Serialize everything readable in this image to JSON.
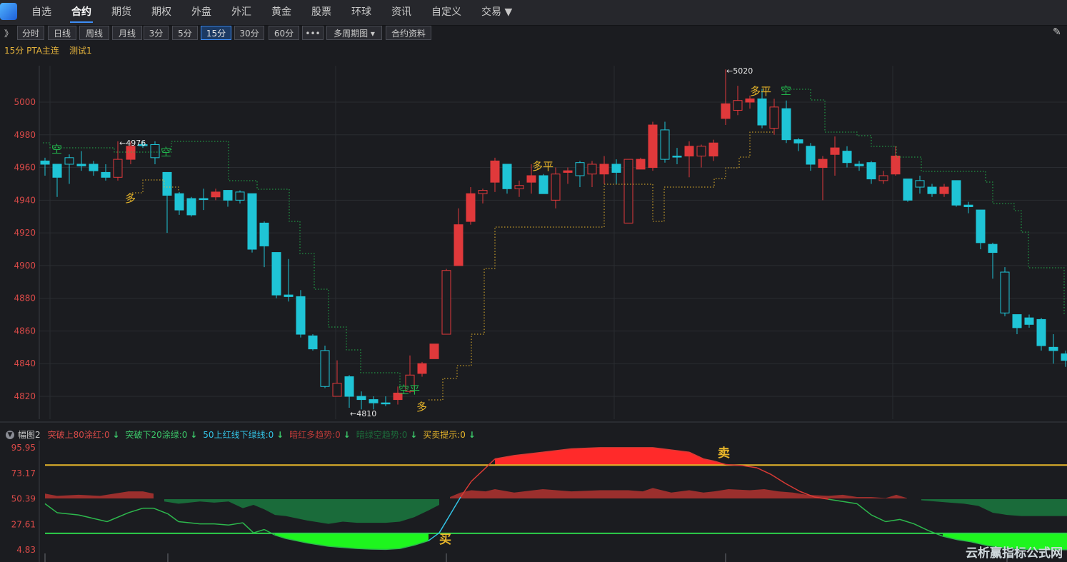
{
  "app": {
    "logo": "chart-logo"
  },
  "nav": {
    "items": [
      "自选",
      "合约",
      "期货",
      "期权",
      "外盘",
      "外汇",
      "黄金",
      "股票",
      "环球",
      "资讯",
      "自定义",
      "交易"
    ],
    "active": 1,
    "dropdown_arrow": "▼"
  },
  "toolbar": {
    "expand": "》",
    "items": [
      "分时",
      "日线",
      "周线",
      "月线",
      "3分",
      "5分",
      "15分",
      "30分",
      "60分",
      "•••",
      "多周期图 ▾",
      "合约资料"
    ],
    "active": "15分",
    "edit_icon": "✎"
  },
  "title": {
    "contract": "15分 PTA主连",
    "indicator": "测试1"
  },
  "main_chart": {
    "y_ticks": [
      "5000",
      "4980",
      "4960",
      "4940",
      "4920",
      "4900",
      "4880",
      "4860",
      "4840",
      "4820"
    ],
    "annotations": {
      "high": "←5020",
      "low": "←4810",
      "local_high": "←4976"
    },
    "signals": {
      "duo": "多",
      "kong": "空",
      "duoping": "多平",
      "kongping": "空平"
    },
    "colors": {
      "up": "#e0393b",
      "down": "#1fc4d6",
      "text": "#d94a48",
      "duo": "#e8b62a",
      "kong": "#22b34b"
    }
  },
  "sub_chart": {
    "title": "幅图2",
    "legend": [
      {
        "text": "突破上80涂红:0",
        "color": "#d94a48"
      },
      {
        "text": "突破下20涂绿:0",
        "color": "#3cc86a"
      },
      {
        "text": "50上红线下绿线:0",
        "color": "#33c3e5"
      },
      {
        "text": "暗红多趋势:0",
        "color": "#b83a38"
      },
      {
        "text": "暗绿空趋势:0",
        "color": "#1c6a3a"
      },
      {
        "text": "买卖提示:0",
        "color": "#e8b62a"
      }
    ],
    "y_ticks": [
      "95.95",
      "73.17",
      "50.39",
      "27.61",
      "4.83"
    ],
    "labels": {
      "sell": "卖",
      "buy": "买"
    }
  },
  "watermark": "云析赢指标公式网"
}
